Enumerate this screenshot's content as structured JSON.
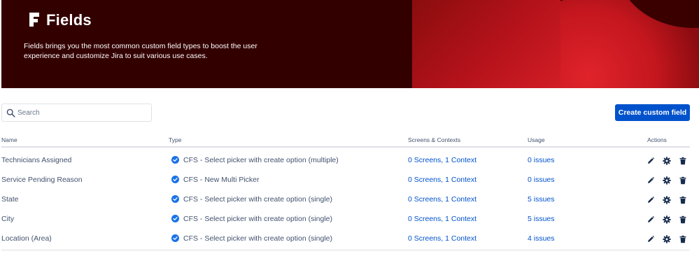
{
  "hero": {
    "title": "Fields",
    "description": "Fields brings you the most common custom field types to boost the user experience and customize Jira to suit various use cases."
  },
  "search": {
    "placeholder": "Search",
    "value": ""
  },
  "create_button": "Create custom field",
  "columns": {
    "name": "Name",
    "type": "Type",
    "screens": "Screens & Contexts",
    "usage": "Usage",
    "actions": "Actions"
  },
  "rows": [
    {
      "name": "Technicians Assigned",
      "type": "CFS - Select picker with create option (multiple)",
      "screens": "0 Screens, 1 Context",
      "usage": "0 issues"
    },
    {
      "name": "Service Pending Reason",
      "type": "CFS - New Multi Picker",
      "screens": "0 Screens, 1 Context",
      "usage": "0 issues"
    },
    {
      "name": "State",
      "type": "CFS - Select picker with create option (single)",
      "screens": "0 Screens, 1 Context",
      "usage": "5 issues"
    },
    {
      "name": "City",
      "type": "CFS - Select picker with create option (single)",
      "screens": "0 Screens, 1 Context",
      "usage": "5 issues"
    },
    {
      "name": "Location (Area)",
      "type": "CFS - Select picker with create option (single)",
      "screens": "0 Screens, 1 Context",
      "usage": "4 issues"
    }
  ],
  "icons": {
    "type_badge": "check-circle-icon",
    "edit": "pencil-icon",
    "settings": "gear-icon",
    "delete": "trash-icon",
    "search": "search-icon",
    "logo": "fields-logo-icon"
  },
  "colors": {
    "primary": "#0052cc",
    "hero_dark": "#330000",
    "hero_red": "#c4161e",
    "badge_blue": "#1a73e8"
  }
}
